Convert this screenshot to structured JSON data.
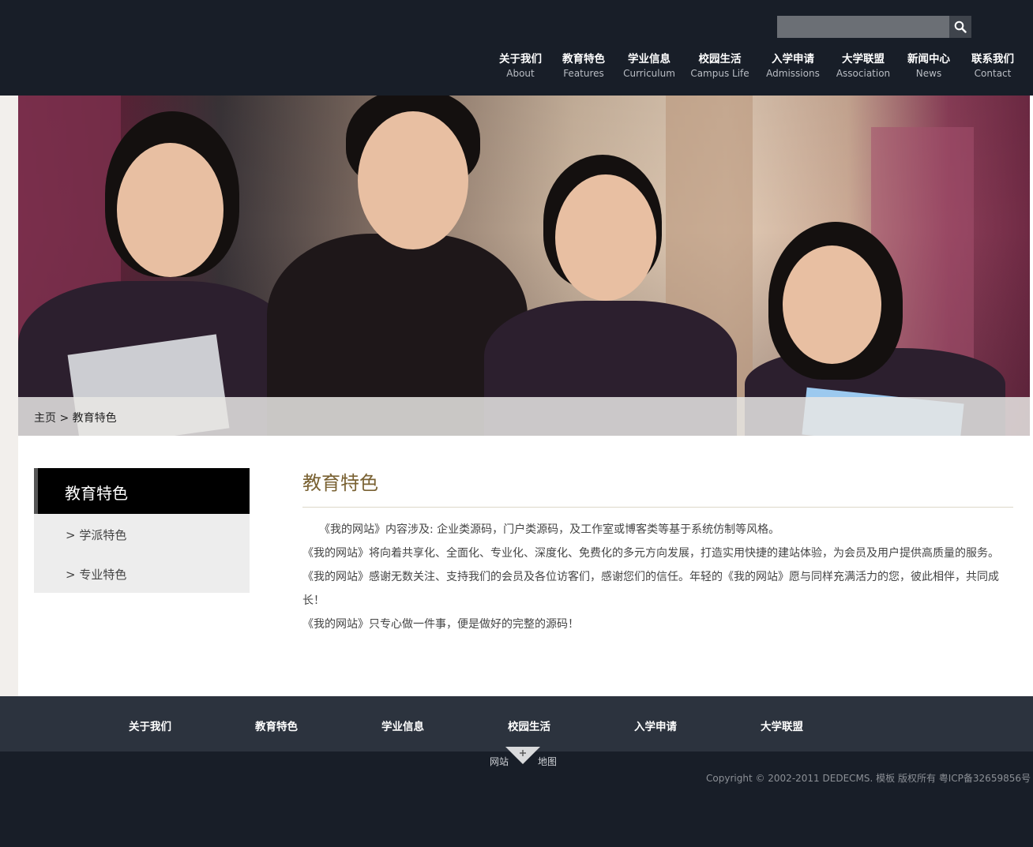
{
  "search": {
    "placeholder": "",
    "value": ""
  },
  "nav": [
    {
      "zh": "关于我们",
      "en": "About"
    },
    {
      "zh": "教育特色",
      "en": "Features"
    },
    {
      "zh": "学业信息",
      "en": "Curriculum"
    },
    {
      "zh": "校园生活",
      "en": "Campus Life"
    },
    {
      "zh": "入学申请",
      "en": "Admissions"
    },
    {
      "zh": "大学联盟",
      "en": "Association"
    },
    {
      "zh": "新闻中心",
      "en": "News"
    },
    {
      "zh": "联系我们",
      "en": "Contact"
    }
  ],
  "breadcrumb": {
    "home": "主页",
    "separator": " > ",
    "current": "教育特色"
  },
  "sidebar": {
    "title": "教育特色",
    "items": [
      "> 学派特色",
      "> 专业特色"
    ]
  },
  "main": {
    "title": "教育特色",
    "paragraphs": [
      "　　《我的网站》内容涉及: 企业类源码，门户类源码，及工作室或博客类等基于系统仿制等风格。",
      "《我的网站》将向着共享化、全面化、专业化、深度化、免费化的多元方向发展，打造实用快捷的建站体验，为会员及用户提供高质量的服务。",
      "《我的网站》感谢无数关注、支持我们的会员及各位访客们，感谢您们的信任。年轻的《我的网站》愿与同样充满活力的您，彼此相伴，共同成长！",
      "《我的网站》只专心做一件事，便是做好的完整的源码！"
    ]
  },
  "footer": {
    "nav": [
      "关于我们",
      "教育特色",
      "学业信息",
      "校园生活",
      "入学申请",
      "大学联盟"
    ],
    "sitemap_left": "网站",
    "sitemap_right": "地图",
    "copyright": "Copyright © 2002-2011 DEDECMS. 模板 版权所有 粤ICP备32659856号"
  },
  "colors": {
    "header_bg": "#181e28",
    "footer_nav_bg": "#2c333e",
    "title_accent": "#7a6233"
  }
}
